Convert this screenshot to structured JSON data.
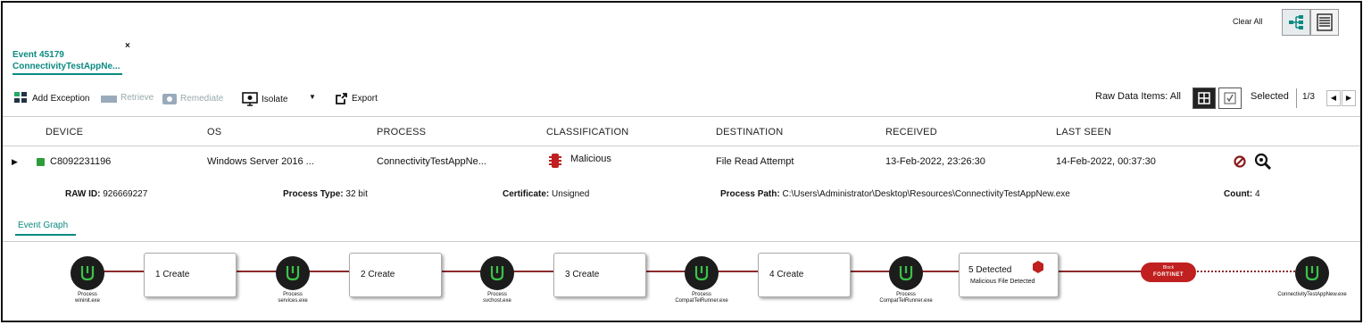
{
  "tab": {
    "event": "Event 45179",
    "name": "ConnectivityTestAppNe...",
    "close": "×"
  },
  "top_right": {
    "clear_all": "Clear All"
  },
  "toolbar": {
    "add_exception": "Add Exception",
    "retrieve": "Retrieve",
    "remediate": "Remediate",
    "isolate": "Isolate",
    "export": "Export",
    "raw_data_items": "Raw Data Items: All",
    "selected": "Selected",
    "pagination": "1/3"
  },
  "columns": [
    "DEVICE",
    "OS",
    "PROCESS",
    "CLASSIFICATION",
    "DESTINATION",
    "RECEIVED",
    "LAST SEEN"
  ],
  "row": {
    "device": "C8092231196",
    "os": "Windows Server 2016 ...",
    "process": "ConnectivityTestAppNe...",
    "classification": "Malicious",
    "destination": "File Read Attempt",
    "received": "13-Feb-2022, 23:26:30",
    "last_seen": "14-Feb-2022, 00:37:30"
  },
  "details": {
    "raw_id_label": "RAW ID:",
    "raw_id": "926669227",
    "process_type_label": "Process Type:",
    "process_type": "32 bit",
    "certificate_label": "Certificate:",
    "certificate": "Unsigned",
    "process_path_label": "Process Path:",
    "process_path": "C:\\Users\\Administrator\\Desktop\\Resources\\ConnectivityTestAppNew.exe",
    "count_label": "Count:",
    "count": "4"
  },
  "event_graph_tab": "Event Graph",
  "graph": {
    "nodes": [
      {
        "line1": "Process",
        "line2": "wininit.exe"
      },
      {
        "line1": "Process",
        "line2": "services.exe"
      },
      {
        "line1": "Process",
        "line2": "svchost.exe"
      },
      {
        "line1": "Process",
        "line2": "CompatTelRunner.exe"
      },
      {
        "line1": "Process",
        "line2": "CompatTelRunner.exe"
      },
      {
        "line1": "ConnectivityTestAppNew.exe",
        "line2": ""
      }
    ],
    "steps": [
      {
        "label": "1 Create"
      },
      {
        "label": "2 Create"
      },
      {
        "label": "3 Create"
      },
      {
        "label": "4 Create"
      },
      {
        "label": "5 Detected",
        "sub": "Malicious File Detected"
      }
    ],
    "badge": {
      "top": "Block",
      "brand": "FORTINET"
    }
  },
  "colors": {
    "accent": "#0a8a80",
    "malicious": "#c0201f",
    "edge": "#8b2a2a",
    "device_status": "#2e9c3a"
  }
}
